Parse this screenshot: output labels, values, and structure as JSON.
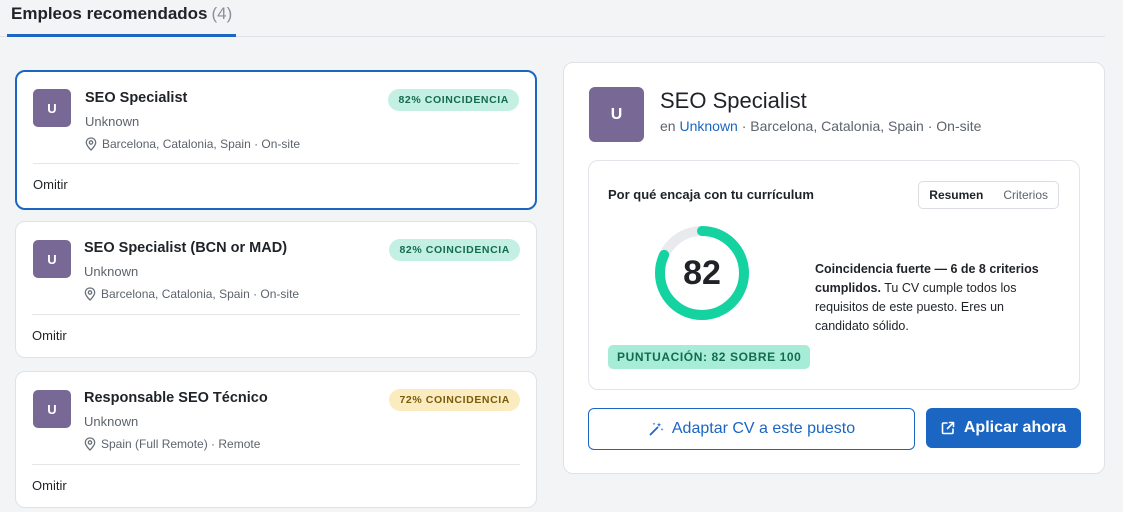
{
  "header": {
    "tab_label": "Empleos recomendados",
    "tab_count": "(4)"
  },
  "jobs": [
    {
      "logo_letter": "U",
      "title": "SEO Specialist",
      "company": "Unknown",
      "location": "Barcelona, Catalonia, Spain · On-site",
      "badge": "82% COINCIDENCIA",
      "omit_label": "Omitir"
    },
    {
      "logo_letter": "U",
      "title": "SEO Specialist (BCN or MAD)",
      "company": "Unknown",
      "location": "Barcelona, Catalonia, Spain · On-site",
      "badge": "82% COINCIDENCIA",
      "omit_label": "Omitir"
    },
    {
      "logo_letter": "U",
      "title": "Responsable SEO Técnico",
      "company": "Unknown",
      "location": "Spain (Full Remote) · Remote",
      "badge": "72% COINCIDENCIA",
      "omit_label": "Omitir"
    }
  ],
  "detail": {
    "logo_letter": "U",
    "title": "SEO Specialist",
    "sub_prefix": "en",
    "company_link": "Unknown",
    "sub_suffix": "· Barcelona, Catalonia, Spain · On-site",
    "fit": {
      "title": "Por qué encaja con tu currículum",
      "tab_summary": "Resumen",
      "tab_criteria": "Criterios",
      "score": "82",
      "score_fraction": 0.82,
      "desc_bold": "Coincidencia fuerte — 6 de 8 criterios cumplidos.",
      "desc_rest": "Tu CV cumple todos los requisitos de este puesto. Eres un candidato sólido.",
      "score_label": "PUNTUACIÓN: 82 SOBRE 100"
    },
    "adapt_button": "Adaptar CV a este puesto",
    "apply_button": "Aplicar ahora"
  },
  "icons": {
    "location": "map-pin-icon",
    "adapt": "magic-wand-icon",
    "apply": "external-link-icon"
  },
  "colors": {
    "accent": "#1a66c2",
    "match_green": "#14d3a0",
    "avatar": "#776895"
  }
}
